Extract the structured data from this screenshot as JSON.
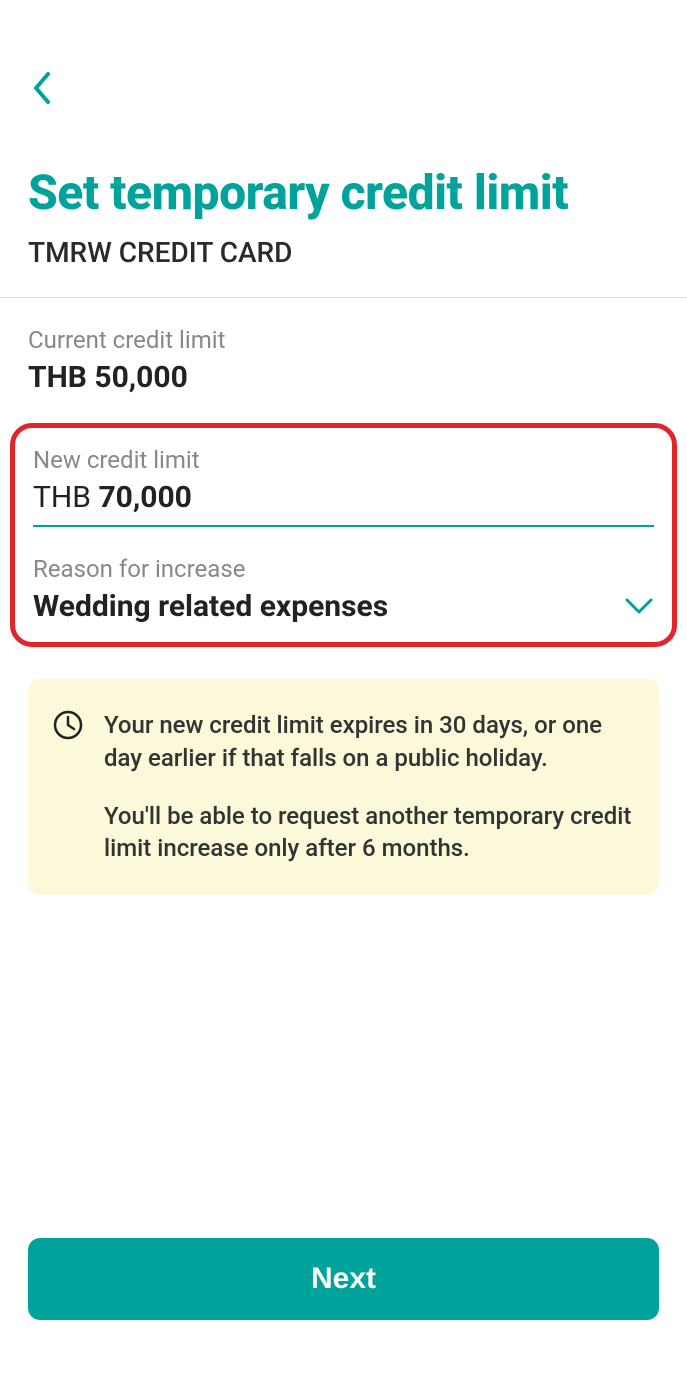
{
  "header": {
    "title": "Set temporary credit limit",
    "subtitle": "TMRW CREDIT CARD"
  },
  "currentLimit": {
    "label": "Current credit limit",
    "value": "THB 50,000"
  },
  "newLimit": {
    "label": "New credit limit",
    "currency": "THB ",
    "amount": "70,000"
  },
  "reason": {
    "label": "Reason for increase",
    "value": "Wedding related expenses"
  },
  "infoBox": {
    "line1": "Your new credit limit expires in 30 days, or one day earlier if that falls on a public holiday.",
    "line2": "You'll be able to request another temporary credit limit increase only after 6 months."
  },
  "buttons": {
    "next": "Next"
  },
  "colors": {
    "accent": "#00A39B",
    "highlight": "#E2252B",
    "infoBg": "#FCF8DA"
  }
}
